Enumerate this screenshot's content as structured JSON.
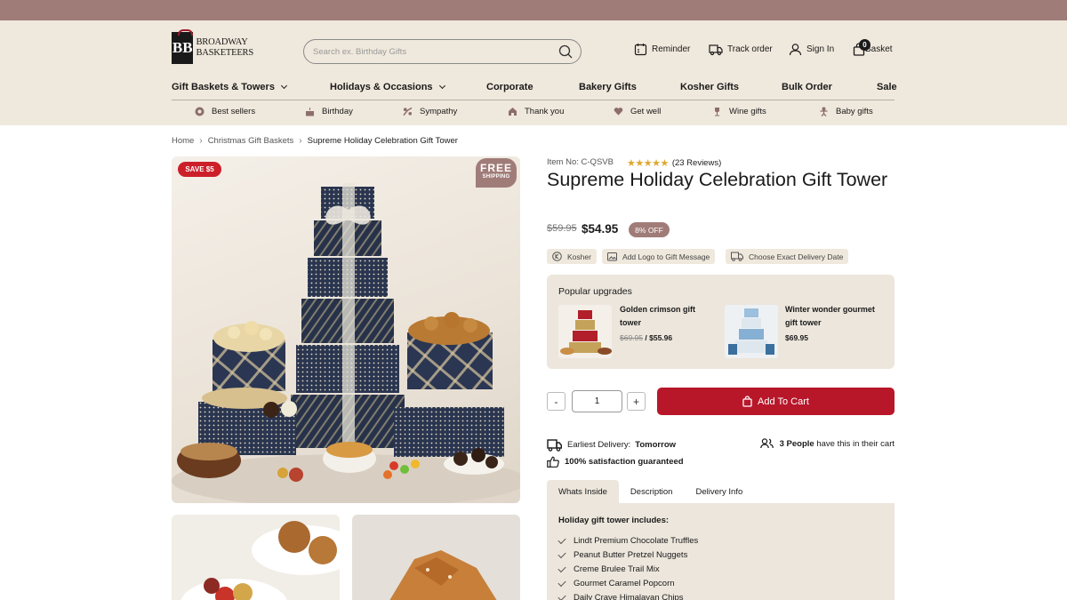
{
  "brand": {
    "line1": "BROADWAY",
    "line2": "BASKETEERS",
    "monogram": "BB"
  },
  "search": {
    "placeholder": "Search ex. Birthday Gifts"
  },
  "header_actions": {
    "reminder": "Reminder",
    "track": "Track order",
    "signin": "Sign In",
    "basket": "Basket",
    "basket_count": "0"
  },
  "main_nav": [
    {
      "label": "Gift Baskets & Towers",
      "dropdown": true
    },
    {
      "label": "Holidays & Occasions",
      "dropdown": true
    },
    {
      "label": "Corporate",
      "dropdown": false
    },
    {
      "label": "Bakery Gifts",
      "dropdown": false
    },
    {
      "label": "Kosher Gifts",
      "dropdown": false
    },
    {
      "label": "Bulk Order",
      "dropdown": false
    },
    {
      "label": "Sale",
      "dropdown": false
    }
  ],
  "sub_nav": [
    {
      "label": "Best sellers",
      "icon": "badge-icon"
    },
    {
      "label": "Birthday",
      "icon": "cake-icon"
    },
    {
      "label": "Sympathy",
      "icon": "flower-icon"
    },
    {
      "label": "Thank you",
      "icon": "hands-icon"
    },
    {
      "label": "Get well",
      "icon": "heart-icon"
    },
    {
      "label": "Wine gifts",
      "icon": "wine-glass-icon"
    },
    {
      "label": "Baby gifts",
      "icon": "baby-icon"
    }
  ],
  "breadcrumb": {
    "home": "Home",
    "category": "Christmas Gift Baskets",
    "current": "Supreme Holiday Celebration Gift Tower"
  },
  "badges": {
    "save": "SAVE $5",
    "free_line1": "FREE",
    "free_line2": "SHIPPING"
  },
  "product": {
    "item_no": "Item No: C-QSVB",
    "rating": 4.5,
    "reviews": "(23 Reviews)",
    "title": "Supreme Holiday Celebration Gift Tower",
    "old_price": "$59.95",
    "price": "$54.95",
    "discount": "8% OFF",
    "tags": [
      "Kosher",
      "Add Logo to Gift Message",
      "Choose Exact Delivery Date"
    ]
  },
  "upgrades": {
    "heading": "Popular upgrades",
    "items": [
      {
        "name": "Golden crimson gift tower",
        "old_price": "$69.95",
        "sep": "/",
        "price": "$55.96"
      },
      {
        "name": "Winter wonder gourmet gift tower",
        "price": "$69.95"
      }
    ]
  },
  "quantity": {
    "minus": "-",
    "value": "1",
    "plus": "+"
  },
  "cart": {
    "label": "Add To Cart"
  },
  "delivery": {
    "label": "Earliest Delivery:",
    "value": "Tomorrow"
  },
  "people": {
    "count": "3 People",
    "text": "have this in their cart"
  },
  "satisfaction": "100% satisfaction guaranteed",
  "tabs": [
    "Whats Inside",
    "Description",
    "Delivery Info"
  ],
  "contents": {
    "heading": "Holiday gift tower includes:",
    "items": [
      "Lindt Premium Chocolate Truffles",
      "Peanut Butter Pretzel Nuggets",
      "Creme Brulee Trail Mix",
      "Gourmet Caramel Popcorn",
      "Daily Crave Himalayan Chips"
    ]
  },
  "colors": {
    "topbar": "#a07c78",
    "header_bg": "#efe8dc",
    "cart_button": "#b8172a",
    "save_badge": "#cc1f2a",
    "star": "#e0a82e"
  }
}
